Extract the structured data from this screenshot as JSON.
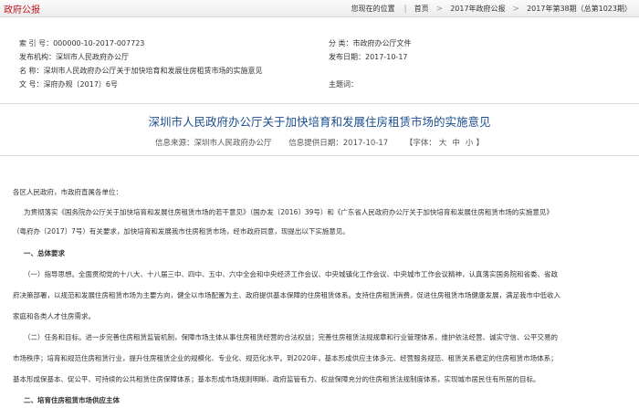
{
  "header": {
    "section": "政府公报",
    "crumbs": [
      "您现在的位置",
      "首页",
      "2017年政府公报",
      "2017年第38期（总第1023期）"
    ]
  },
  "meta": {
    "index_label": "索 引 号：",
    "index_value": "000000-10-2017-007723",
    "category_label": "分 类：",
    "category_value": "市政府办公厅文件",
    "agency_label": "发布机构：",
    "agency_value": "深圳市人民政府办公厅",
    "date_label": "发布日期：",
    "date_value": "2017-10-17",
    "name_label": "名 称：",
    "name_value": "深圳市人民政府办公厅关于加快培育和发展住房租赁市场的实施意见",
    "docno_label": "文 号：",
    "docno_value": "深府办规〔2017〕6号",
    "subject_label": "主题词："
  },
  "title": "深圳市人民政府办公厅关于加快培育和发展住房租赁市场的实施意见",
  "info": {
    "source": "信息来源：深圳市人民政府办公厅",
    "provided": "信息提供日期：2017-10-17",
    "font_label": "【字体：",
    "font_large": "大",
    "font_medium": "中",
    "font_small": "小",
    "font_close": "】"
  },
  "article": {
    "greeting": "各区人民政府，市政府直属各单位：",
    "intro_1": "为贯彻落实《国务院办公厅关于加快培育和发展住房租赁市场的若干意见》（国办发〔2016〕39号）和《广东省人民政府办公厅关于加快培育和发展住房租赁市场的实施意见》",
    "intro_2": "（粤府办〔2017〕7号）有关要求，加快培育和发展我市住房租赁市场，经市政府同意，现提出以下实施意见。",
    "h1": "一、总体要求",
    "p1_1": "（一）指导思想。全面贯彻党的十八大、十八届三中、四中、五中、六中全会和中央经济工作会议、中央城镇化工作会议、中央城市工作会议精神，认真落实国务院和省委、省政",
    "p1_2": "府决策部署，以规范和发展住房租赁市场为主要方向，健全以市场配置为主、政府提供基本保障的住房租赁体系。支持住房租赁消费，促进住房租赁市场健康发展，满足我市中低收入",
    "p1_3": "家庭和各类人才住房需求。",
    "p2_1": "（二）任务和目标。进一步完善住房租赁监管机制，保障市场主体从事住房租赁经营的合法权益；完善住房租赁法规规章和行业管理体系，维护依法经营、诚实守信、公平交易的",
    "p2_2": "市场秩序；培育和规范住房租赁行业，提升住房租赁企业的规模化、专业化、规范化水平。到2020年，基本形成供应主体多元、经营服务规范、租赁关系稳定的住房租赁市场体系；",
    "p2_3": "基本形成保基本、促公平、可持续的公共租赁住房保障体系；基本形成市场规则明晰、政府监管有力、权益保障充分的住房租赁法规制度体系，实现城市居民住有所居的目标。",
    "h2": "二、培育住房租赁市场供应主体"
  }
}
